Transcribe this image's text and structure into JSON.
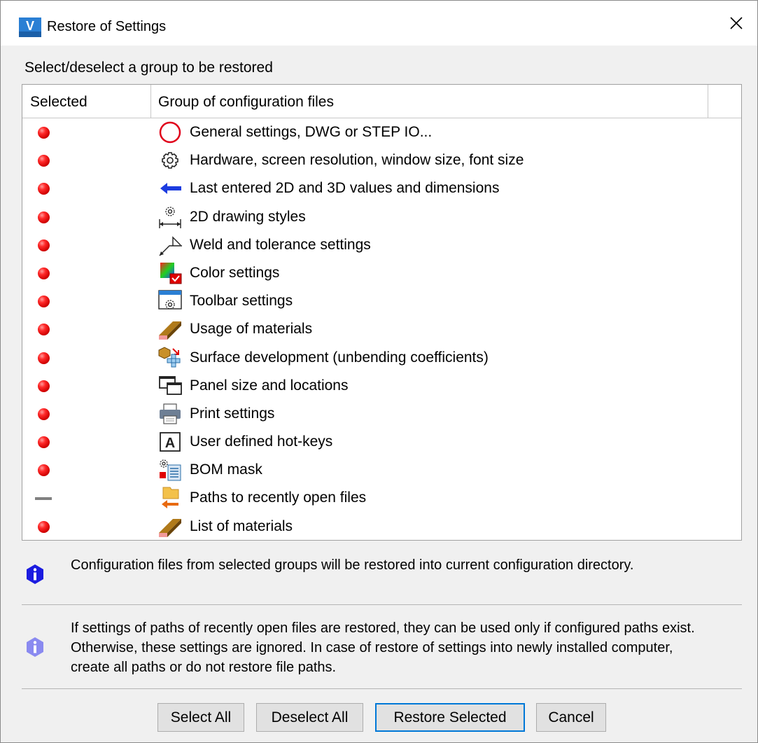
{
  "window": {
    "title": "Restore of Settings",
    "icon_label": "V",
    "close_glyph": "✕"
  },
  "instruction": "Select/deselect a group to be restored",
  "table": {
    "columns": [
      "Selected",
      "Group of configuration files"
    ],
    "rows": [
      {
        "selected": true,
        "icon": "circle-icon",
        "label": "General settings, DWG or STEP IO..."
      },
      {
        "selected": true,
        "icon": "gear-icon",
        "label": "Hardware, screen resolution, window size, font size"
      },
      {
        "selected": true,
        "icon": "arrow-left-icon",
        "label": "Last entered 2D and 3D values and dimensions"
      },
      {
        "selected": true,
        "icon": "dimension-gear-icon",
        "label": "2D drawing styles"
      },
      {
        "selected": true,
        "icon": "weld-symbol-icon",
        "label": "Weld and tolerance settings"
      },
      {
        "selected": true,
        "icon": "color-palette-icon",
        "label": "Color settings"
      },
      {
        "selected": true,
        "icon": "toolbar-gear-icon",
        "label": "Toolbar settings"
      },
      {
        "selected": true,
        "icon": "material-bar-icon",
        "label": "Usage of materials"
      },
      {
        "selected": true,
        "icon": "unfold-box-icon",
        "label": "Surface development (unbending coefficients)"
      },
      {
        "selected": true,
        "icon": "panels-icon",
        "label": "Panel size and locations"
      },
      {
        "selected": true,
        "icon": "printer-icon",
        "label": "Print settings"
      },
      {
        "selected": true,
        "icon": "hotkey-icon",
        "label": "User defined hot-keys",
        "icon_text": "A"
      },
      {
        "selected": true,
        "icon": "bom-icon",
        "label": "BOM mask"
      },
      {
        "selected": false,
        "icon": "folder-arrow-icon",
        "label": "Paths to recently open files"
      },
      {
        "selected": true,
        "icon": "material-bar-icon",
        "label": "List of materials"
      }
    ]
  },
  "info": [
    {
      "icon": "info-icon",
      "color": "#1c1ce0",
      "text": "Configuration files from selected groups will be restored into current configuration directory."
    },
    {
      "icon": "info-icon",
      "color": "#8a8af0",
      "text": "If settings of paths of recently open files are restored, they can be used only if configured paths exist. Otherwise, these settings are ignored. In case of restore of settings into newly installed computer, create all paths or do not restore file paths."
    }
  ],
  "buttons": {
    "select_all": "Select All",
    "deselect_all": "Deselect All",
    "restore_selected": "Restore Selected",
    "cancel": "Cancel"
  },
  "colors": {
    "selected_dot": "#e00000",
    "accent": "#0078d7"
  }
}
